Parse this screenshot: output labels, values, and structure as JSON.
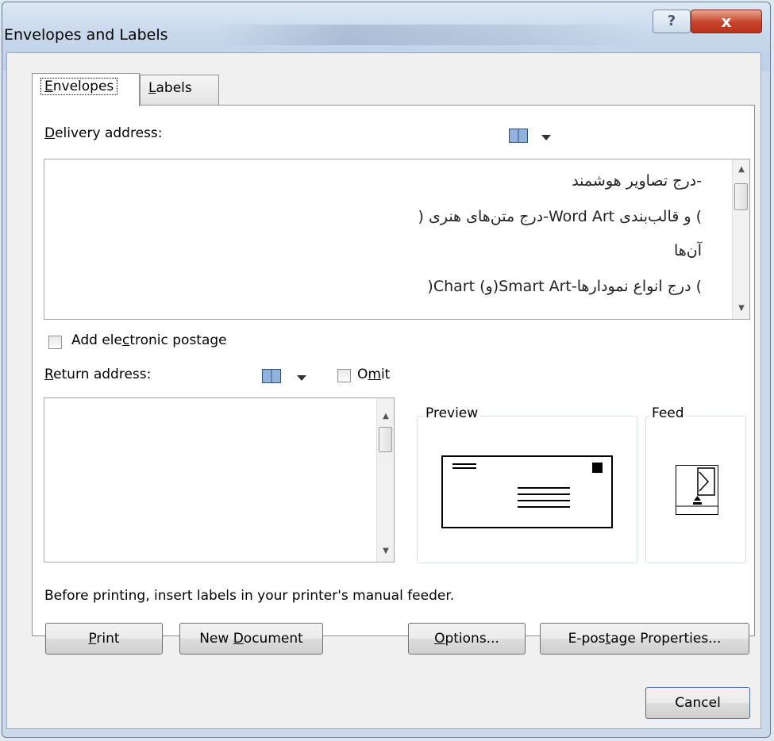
{
  "window": {
    "title": "Envelopes and Labels",
    "help_label": "?",
    "close_label": "x"
  },
  "tabs": [
    {
      "label": "Envelopes",
      "mnemonic": "E",
      "rest": "nvelopes",
      "active": true
    },
    {
      "label": "Labels",
      "mnemonic": "L",
      "rest": "abels",
      "active": false
    }
  ],
  "delivery": {
    "label_mnemonic": "D",
    "label_rest": "elivery address:",
    "lines": [
      "-درج تصاوير هوشمند",
      ") و قالب‌بندی Word Art-درج متن‌های هنری (",
      "آن‌ها",
      ") درج انواع نمودارها-Smart Art(و) Chart("
    ]
  },
  "postage": {
    "label_pre": "Add ele",
    "mnemonic": "c",
    "label_post": "tronic postage",
    "checked": false
  },
  "return": {
    "label_mnemonic": "R",
    "label_rest": "eturn address:",
    "omit_pre": "O",
    "omit_mnemonic": "m",
    "omit_post": "it",
    "omit_checked": false,
    "value": ""
  },
  "preview": {
    "title": "Preview"
  },
  "feed": {
    "title": "Feed"
  },
  "notice": "Before printing, insert labels in your printer's manual feeder.",
  "buttons": {
    "print_mnemonic": "P",
    "print_rest": "rint",
    "newdoc_pre": "New ",
    "newdoc_mnemonic": "D",
    "newdoc_post": "ocument",
    "options_mnemonic": "O",
    "options_rest": "ptions...",
    "epostage_pre": "E-pos",
    "epostage_mnemonic": "t",
    "epostage_post": "age Properties...",
    "cancel": "Cancel"
  },
  "icons": {
    "address_book": "address-book-icon",
    "dropdown": "chevron-down-icon",
    "scroll_up": "scroll-up-arrow-icon",
    "scroll_down": "scroll-down-arrow-icon"
  }
}
